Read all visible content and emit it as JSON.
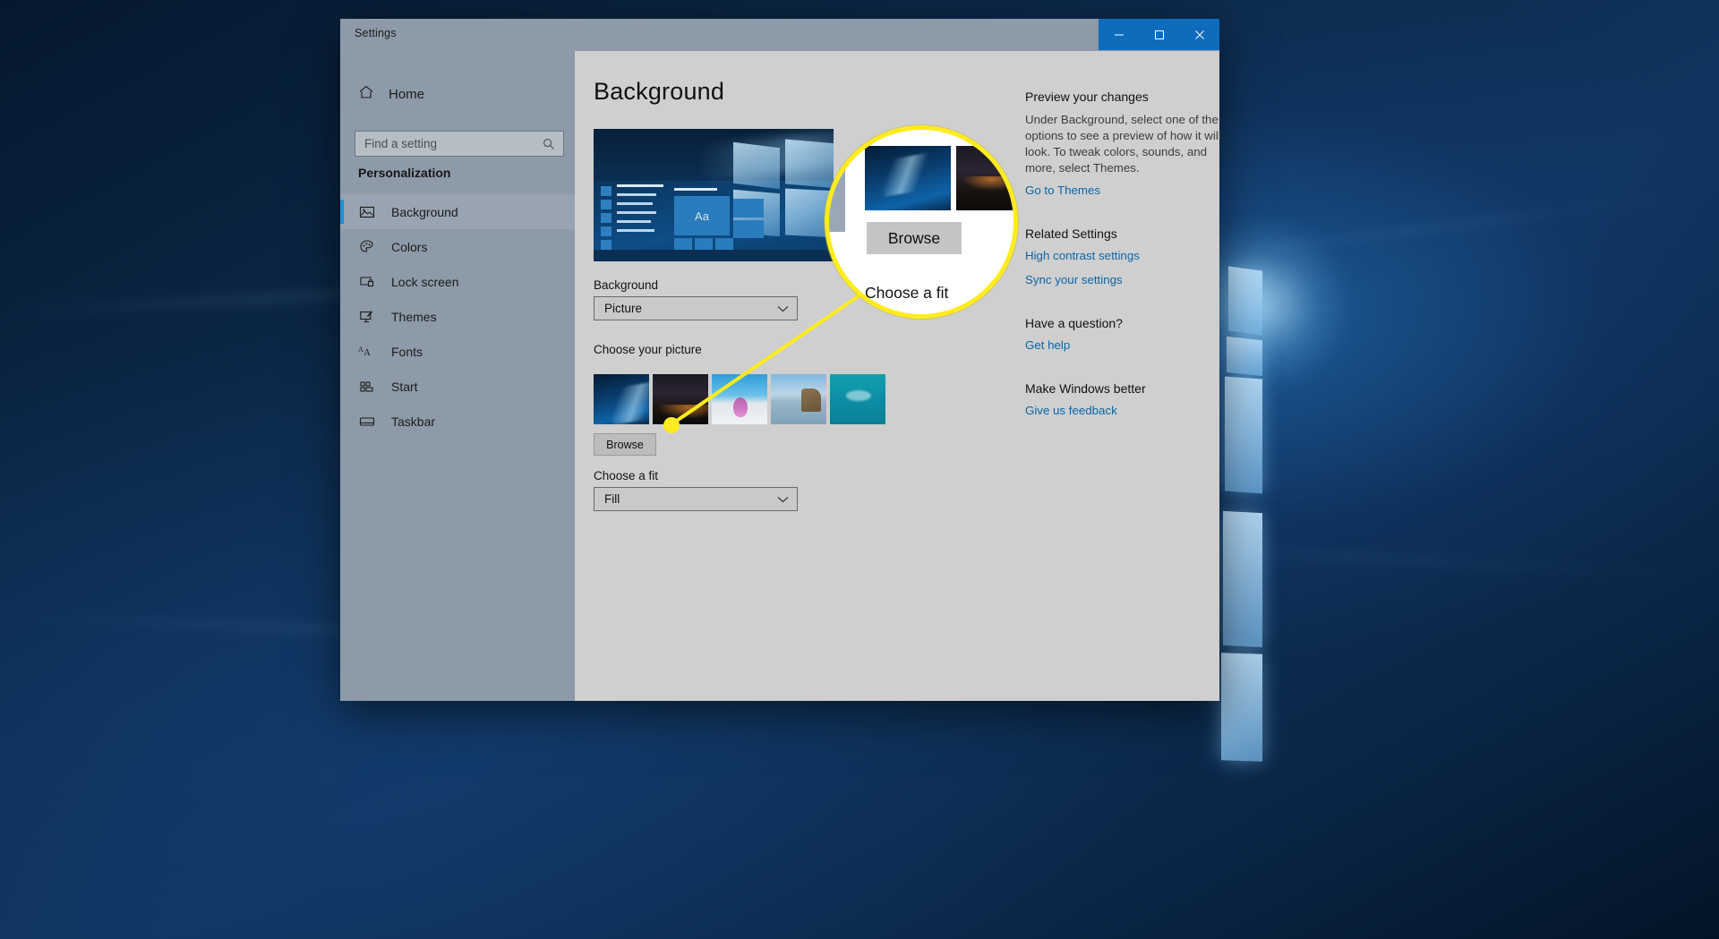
{
  "window": {
    "app_title": "Settings",
    "controls": [
      {
        "name": "minimize",
        "glyph": "minimize-icon"
      },
      {
        "name": "maximize",
        "glyph": "maximize-icon"
      },
      {
        "name": "close",
        "glyph": "close-icon"
      }
    ],
    "titlebar_button_color": "#0f6cbd"
  },
  "sidebar": {
    "home_label": "Home",
    "home_icon": "home-icon",
    "search": {
      "placeholder": "Find a setting",
      "icon": "search-icon",
      "value": ""
    },
    "group_title": "Personalization",
    "items": [
      {
        "label": "Background",
        "icon": "image-icon",
        "selected": true
      },
      {
        "label": "Colors",
        "icon": "palette-icon",
        "selected": false
      },
      {
        "label": "Lock screen",
        "icon": "lock-screen-icon",
        "selected": false
      },
      {
        "label": "Themes",
        "icon": "themes-brush-icon",
        "selected": false
      },
      {
        "label": "Fonts",
        "icon": "fonts-aa-icon",
        "selected": false
      },
      {
        "label": "Start",
        "icon": "start-tiles-icon",
        "selected": false
      },
      {
        "label": "Taskbar",
        "icon": "taskbar-icon",
        "selected": false
      }
    ],
    "accent_color": "#1e8fd5"
  },
  "main": {
    "page_title": "Background",
    "preview_tile_text": "Aa",
    "background_label": "Background",
    "background_value": "Picture",
    "choose_picture_label": "Choose your picture",
    "thumbnails": [
      {
        "name": "windows-hero-wallpaper"
      },
      {
        "name": "night-sky-wallpaper"
      },
      {
        "name": "purple-flower-snow-wallpaper"
      },
      {
        "name": "beach-rock-wallpaper"
      },
      {
        "name": "underwater-turtle-wallpaper"
      }
    ],
    "browse_label": "Browse",
    "choose_fit_label": "Choose a fit",
    "choose_fit_value": "Fill"
  },
  "right_panel": {
    "preview": {
      "heading": "Preview your changes",
      "body": "Under Background, select one of the options to see a preview of how it will look. To tweak colors, sounds, and more, select Themes.",
      "link": "Go to Themes"
    },
    "related": {
      "heading": "Related Settings",
      "links": [
        "High contrast settings",
        "Sync your settings"
      ]
    },
    "question": {
      "heading": "Have a question?",
      "link": "Get help"
    },
    "feedback": {
      "heading": "Make Windows better",
      "link": "Give us feedback"
    },
    "link_color": "#0a66a8"
  },
  "callout": {
    "browse_label": "Browse",
    "choose_fit_label": "Choose a fit",
    "ring_color": "#ffeb1f",
    "pointer_target": "browse-button"
  }
}
